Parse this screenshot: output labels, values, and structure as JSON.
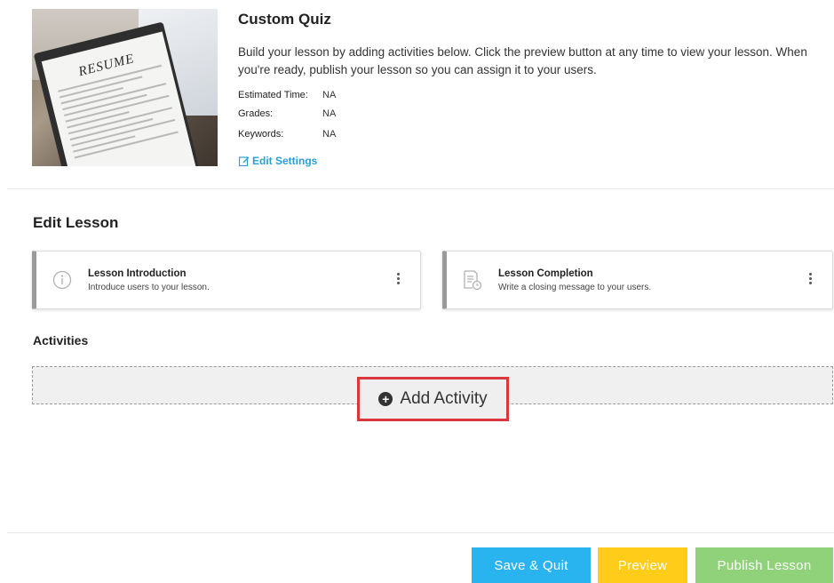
{
  "lesson": {
    "title": "Custom Quiz",
    "description": "Build your lesson by adding activities below. Click the preview button at any time to view your lesson. When you're ready, publish your lesson so you can assign it to your users.",
    "thumbnail_word": "RESUME",
    "meta": [
      {
        "label": "Estimated Time:",
        "value": "NA"
      },
      {
        "label": "Grades:",
        "value": "NA"
      },
      {
        "label": "Keywords:",
        "value": "NA"
      }
    ],
    "edit_settings_label": "Edit Settings"
  },
  "edit_section": {
    "title": "Edit Lesson",
    "cards": [
      {
        "title": "Lesson Introduction",
        "subtitle": "Introduce users to your lesson.",
        "icon": "info-icon"
      },
      {
        "title": "Lesson Completion",
        "subtitle": "Write a closing message to your users.",
        "icon": "document-clock-icon"
      }
    ]
  },
  "activities": {
    "label": "Activities",
    "add_label": "Add Activity"
  },
  "footer": {
    "save_label": "Save & Quit",
    "preview_label": "Preview",
    "publish_label": "Publish Lesson"
  },
  "colors": {
    "link": "#2a9fd6",
    "save": "#29b4f0",
    "preview": "#ffcc1a",
    "publish": "#8fd27a",
    "highlight": "#d9363e"
  }
}
